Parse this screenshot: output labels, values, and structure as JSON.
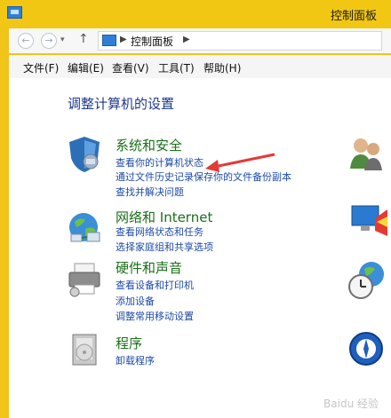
{
  "window": {
    "title": "控制面板"
  },
  "address": {
    "path_label": "控制面板"
  },
  "menu": {
    "items": [
      "文件(F)",
      "编辑(E)",
      "查看(V)",
      "工具(T)",
      "帮助(H)"
    ]
  },
  "main": {
    "heading": "调整计算机的设置",
    "categories": [
      {
        "title": "系统和安全",
        "links": [
          "查看你的计算机状态",
          "通过文件历史记录保存你的文件备份副本",
          "查找并解决问题"
        ],
        "icon": "shield-icon"
      },
      {
        "title": "网络和 Internet",
        "links": [
          "查看网络状态和任务",
          "选择家庭组和共享选项"
        ],
        "icon": "network-icon"
      },
      {
        "title": "硬件和声音",
        "links": [
          "查看设备和打印机",
          "添加设备",
          "调整常用移动设置"
        ],
        "icon": "printer-icon"
      },
      {
        "title": "程序",
        "links": [
          "卸载程序"
        ],
        "icon": "programs-icon"
      }
    ]
  },
  "right_icons": [
    "user-accounts-icon",
    "appearance-icon",
    "clock-region-icon",
    "ease-of-access-icon"
  ],
  "annotation": {
    "arrow_color": "#e53935"
  },
  "watermark": {
    "text": "Baidu 经验"
  }
}
